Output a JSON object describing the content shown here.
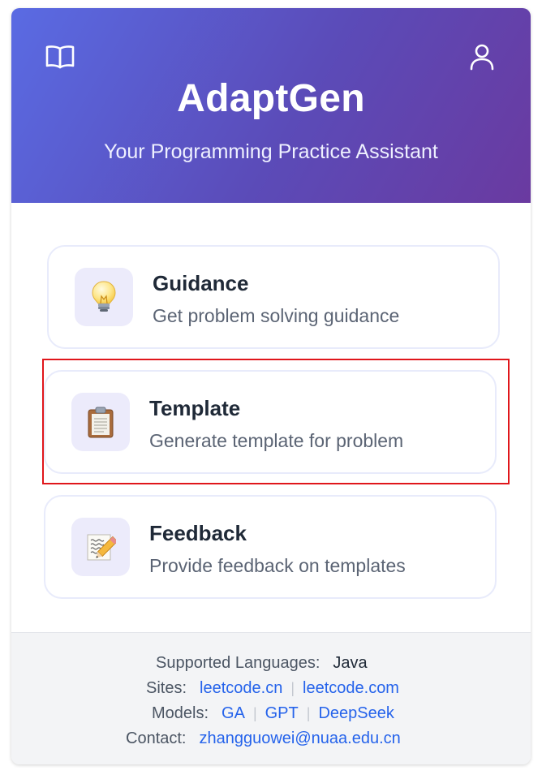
{
  "header": {
    "title": "AdaptGen",
    "subtitle": "Your Programming Practice Assistant",
    "left_icon": "book-icon",
    "right_icon": "user-icon"
  },
  "cards": [
    {
      "title": "Guidance",
      "desc": "Get problem solving guidance",
      "icon": "lightbulb-icon",
      "emoji": "💡"
    },
    {
      "title": "Template",
      "desc": "Generate template for problem",
      "icon": "clipboard-icon",
      "emoji": "📋"
    },
    {
      "title": "Feedback",
      "desc": "Provide feedback on templates",
      "icon": "memo-icon",
      "emoji": "📝"
    }
  ],
  "footer": {
    "languages_label": "Supported Languages:",
    "languages_value": "Java",
    "sites_label": "Sites:",
    "sites": [
      "leetcode.cn",
      "leetcode.com"
    ],
    "models_label": "Models:",
    "models": [
      "GA",
      "GPT",
      "DeepSeek"
    ],
    "contact_label": "Contact:",
    "contact_email": "zhangguowei@nuaa.edu.cn",
    "separator": "|"
  },
  "colors": {
    "header_gradient_start": "#5a6be3",
    "header_gradient_end": "#6a3aa0",
    "link": "#2563eb",
    "highlight": "#e0161b"
  }
}
